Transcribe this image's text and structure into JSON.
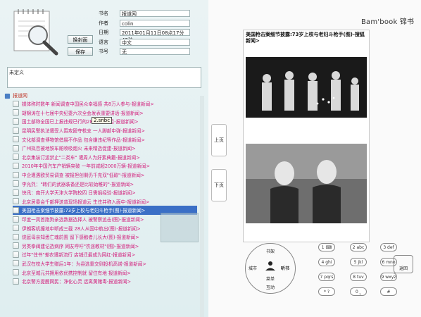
{
  "meta": {
    "fields": [
      {
        "label": "书名",
        "value": "报道网"
      },
      {
        "label": "作者",
        "value": "colin"
      },
      {
        "label": "日期",
        "value": "2011年01月11日08点17分42秒"
      },
      {
        "label": "语言",
        "value": "中文"
      },
      {
        "label": "书号",
        "value": "无"
      }
    ],
    "change_cover_label": "换封面",
    "save_label": "保存",
    "description": "未定义"
  },
  "tree": {
    "root_label": "报道网",
    "tooltip": "2.snbc",
    "items": [
      "媒体称时数年 新闻调查中国民众幸福感 共8万人参与-报道新闻>",
      "胡锦涛在十七届中央纪委六次全会发表重要讲话-报道新闻>",
      "国土部称全国已上报违规已行的287个新项目-报道新闻>",
      "昆明民警执法遭受人围攻殴夺枪支 一人脚部中弹-报道新闻>",
      "文化部调查博物馆借展不作品 包含嫌违纪等作品-报道新闻>",
      "广州拟否被地铁车厢喷吸烟火 未来精选促建-报道新闻>",
      "北京集装订运禁止\"二类车\" 遭周人为好素典籍-报道新闻>",
      "2010年中国汽车产销辆突破 一年前减超2000万辆-报道新闻>",
      "中企遭遇欧贸易调查 被报担创剩仍千克双\"低碳\"-报道新闻>",
      "李允烈：\"韩们的武器装备还是比较幼稚的\"-报道新闻>",
      "快讯：南开大学天津大学院校四 日需捐经验-报道新闻>",
      "北京居委会千部押送普现场报道云 生住并称入面中-报道新闻>",
      "美国枪击案细节披露:73岁上校与老妇斗枪手(图)-报道新闻>",
      "印度一凤首跑狗亲选数据选择人 被警察追击(图)-报道新闻>",
      "伊朗客机撞地中断成三截 28人从国中航出(图)-报道新闻>",
      "烧庭母亲知悉亡魂前置 留下感触者儿长大(图)-报道新闻>",
      "另类拳阀建记选病序 网友呼吁\"农途教材\"(图)-报道新闻>",
      "过年\"住书\"差农遭新流行 店铺迁最成为网红-报道新闻>",
      "武汉在校大学生赠后1年：为县选重交则投机高诺-报道新闻>",
      "北京至城元共拥用依优携控制就 留住有地 报道新闻>",
      "北京警方提醒网民：净化心灵 远离黄赌毒-报道新闻>"
    ]
  },
  "device": {
    "brand": "Bam'book 锦书",
    "headline": "美国枪击案细节披露:73岁上校与老妇斗枪手(图)-搜狐新闻>",
    "page_up": "上页",
    "page_down": "下页",
    "dpad": {
      "up": "书架",
      "left": "城市",
      "center": "听书",
      "down": "菜单",
      "bottom": "互动"
    },
    "keys": [
      "1 ⌨",
      "2 abc",
      "3 def",
      "4 ghi",
      "5 jkl",
      "6 mno",
      "7 pqrs",
      "8 tuv",
      "9 wxyz",
      "* ?",
      "0 ⎵",
      "#"
    ],
    "back_label": "返回"
  }
}
